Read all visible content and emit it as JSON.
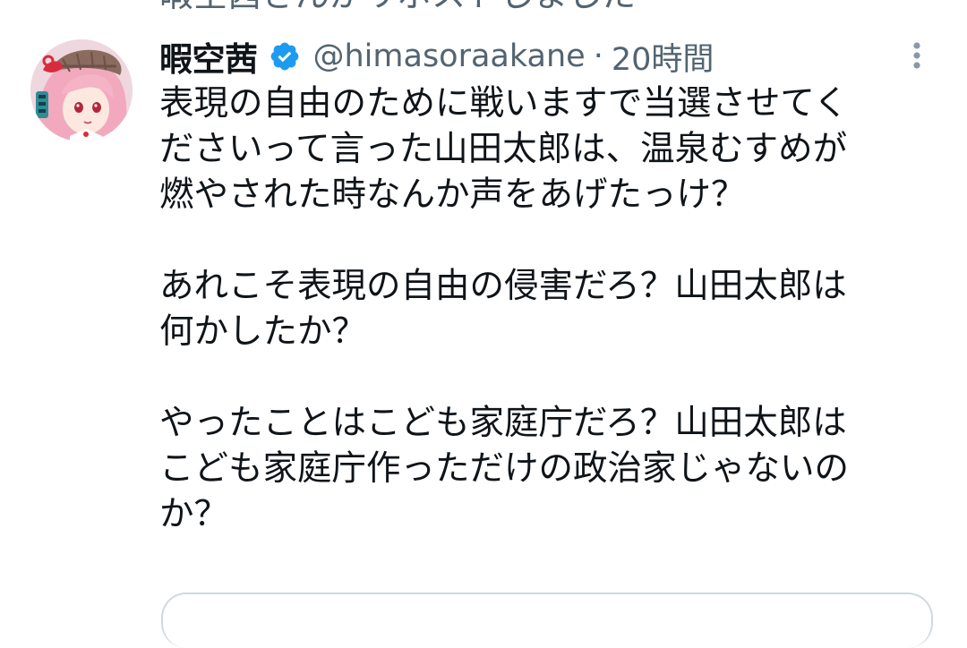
{
  "repost_banner": {
    "text": "暇空茜さんがリポストしました"
  },
  "tweet": {
    "display_name": "暇空茜",
    "handle": "@himasoraakane",
    "separator": "·",
    "time": "20時間",
    "lines": [
      "表現の自由のために戦いますで当選させてく",
      "ださいって言った山田太郎は、温泉むすめが",
      "燃やされた時なんか声をあげたっけ？",
      "",
      "あれこそ表現の自由の侵害だろ？山田太郎は",
      "何かしたか？",
      "",
      "やったことはこども家庭庁だろ？山田太郎は",
      "こども家庭庁作っただけの政治家じゃないの",
      "か？"
    ]
  },
  "colors": {
    "text": "#0f1419",
    "secondary": "#536471",
    "verified": "#1d9bf0",
    "border": "#cfd9de"
  },
  "icons": {
    "verified": "verified-badge-icon",
    "more": "more-vertical-icon"
  }
}
